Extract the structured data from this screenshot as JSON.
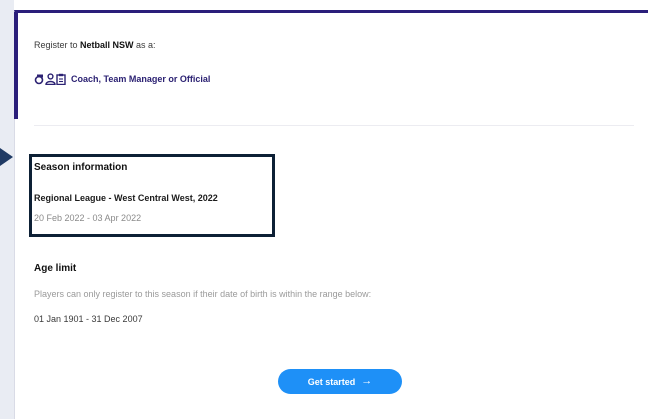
{
  "register": {
    "prefix": "Register to ",
    "org": "Netball NSW",
    "suffix": " as a:"
  },
  "roles": {
    "label": "Coach, Team Manager or Official",
    "icons": [
      "whistle-icon",
      "person-icon",
      "clipboard-icon"
    ]
  },
  "season": {
    "heading": "Season information",
    "name": "Regional League - West Central West, 2022",
    "dates": "20 Feb 2022 - 03 Apr 2022"
  },
  "age_limit": {
    "heading": "Age limit",
    "description": "Players can only register to this season if their date of birth is within the range below:",
    "range": "01 Jan 1901 - 31 Dec 2007"
  },
  "cta": {
    "label": "Get started",
    "arrow": "→"
  },
  "colors": {
    "brand_navy": "#2a1e7a",
    "button_blue": "#1e90f7",
    "highlight_border": "#0d2035"
  }
}
